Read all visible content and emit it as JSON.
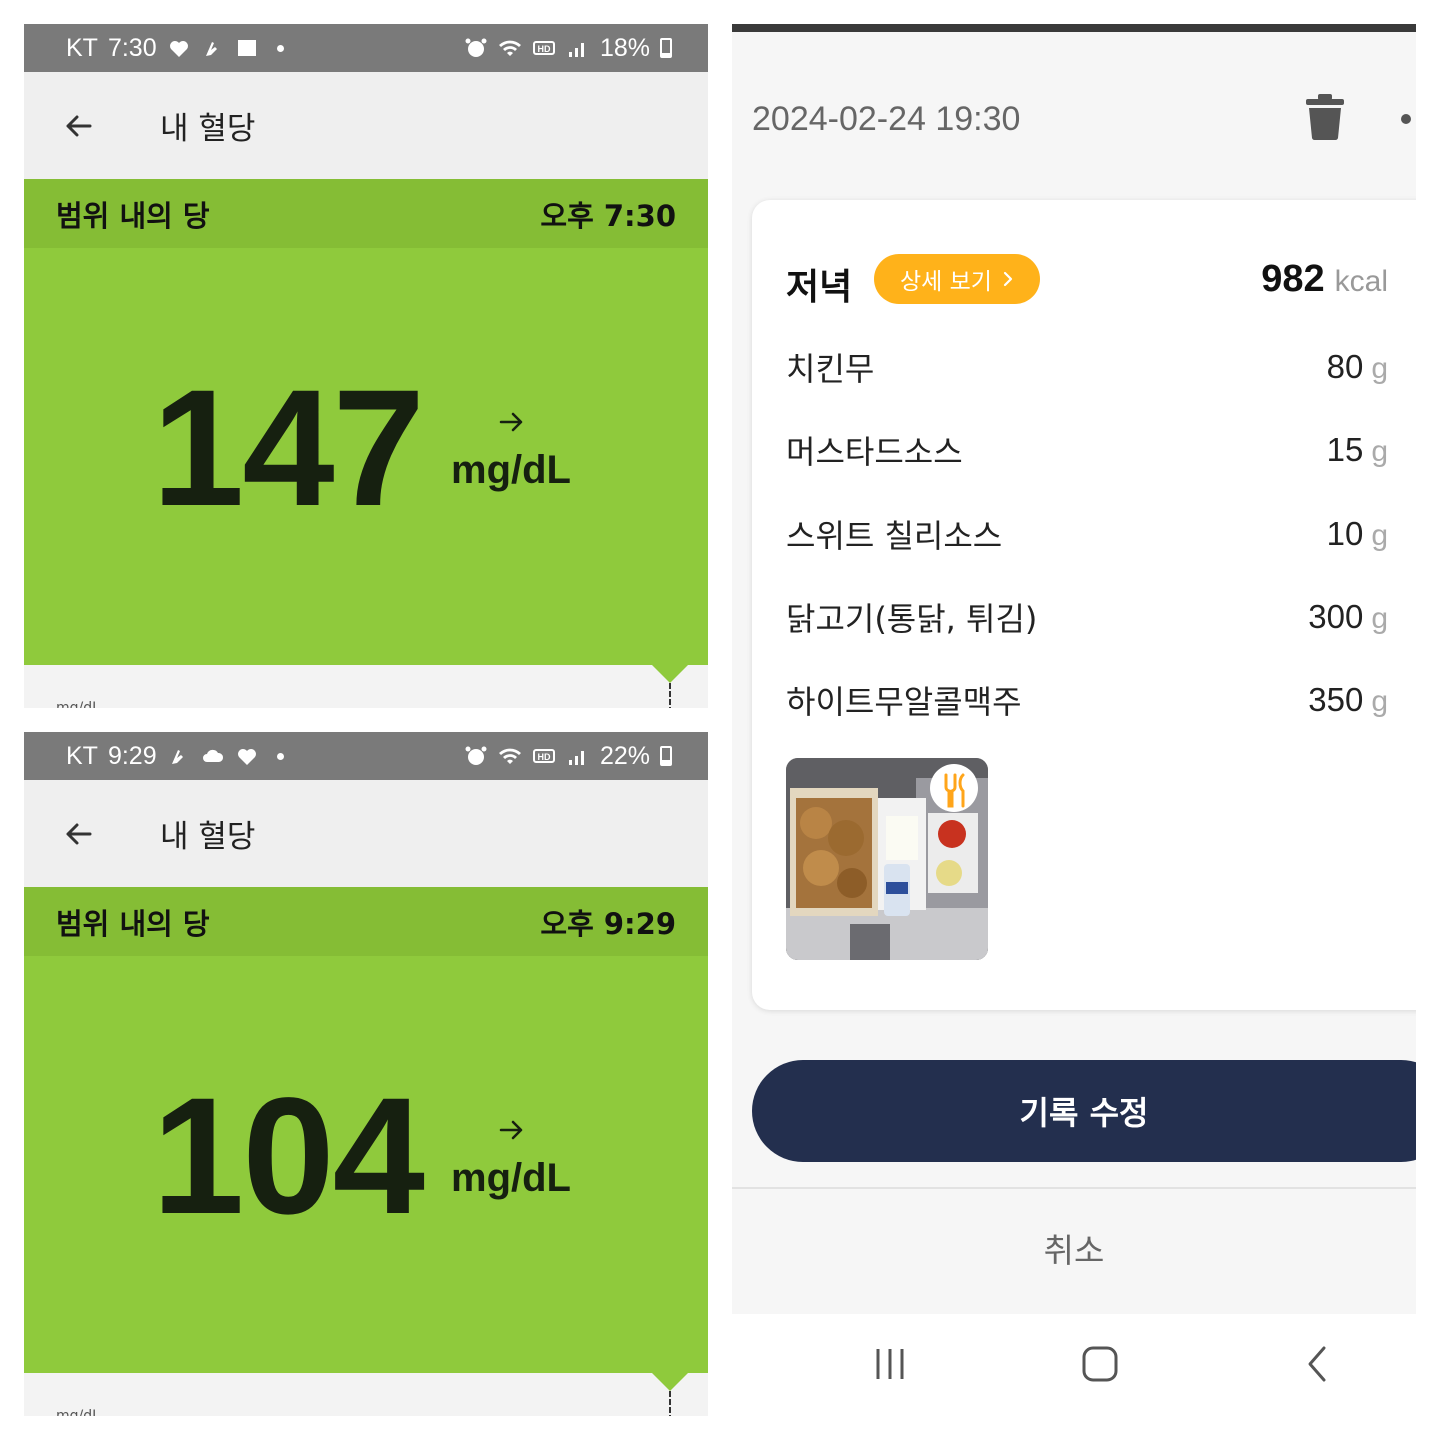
{
  "app": {
    "title": "내 혈당",
    "range_label": "범위 내의 당",
    "unit": "mg/dL",
    "axis_unit": "mg/dL"
  },
  "screens": [
    {
      "carrier": "KT",
      "status_time": "7:30",
      "battery": "18%",
      "battery_level": 0.18,
      "reading_time": "오후 7:30",
      "glucose": "147",
      "trend": "steady-arrow-icon"
    },
    {
      "carrier": "KT",
      "status_time": "9:29",
      "battery": "22%",
      "battery_level": 0.22,
      "reading_time": "오후 9:29",
      "glucose": "104",
      "trend": "steady-arrow-icon"
    }
  ],
  "meal": {
    "datetime": "2024-02-24 19:30",
    "title": "저녁",
    "detail_label": "상세 보기",
    "kcal": "982",
    "kcal_unit": "kcal",
    "foods": [
      {
        "name": "치킨무",
        "amount": "80",
        "unit": "g"
      },
      {
        "name": "머스타드소스",
        "amount": "15",
        "unit": "g"
      },
      {
        "name": "스위트 칠리소스",
        "amount": "10",
        "unit": "g"
      },
      {
        "name": "닭고기(통닭, 튀김)",
        "amount": "300",
        "unit": "g"
      },
      {
        "name": "하이트무알콜맥주",
        "amount": "350",
        "unit": "g"
      }
    ],
    "edit_label": "기록 수정",
    "cancel_label": "취소"
  },
  "colors": {
    "green": "#8fca3c",
    "green_dark": "#85bd35",
    "accent_orange": "#ffb21a",
    "navy": "#232f4e"
  }
}
